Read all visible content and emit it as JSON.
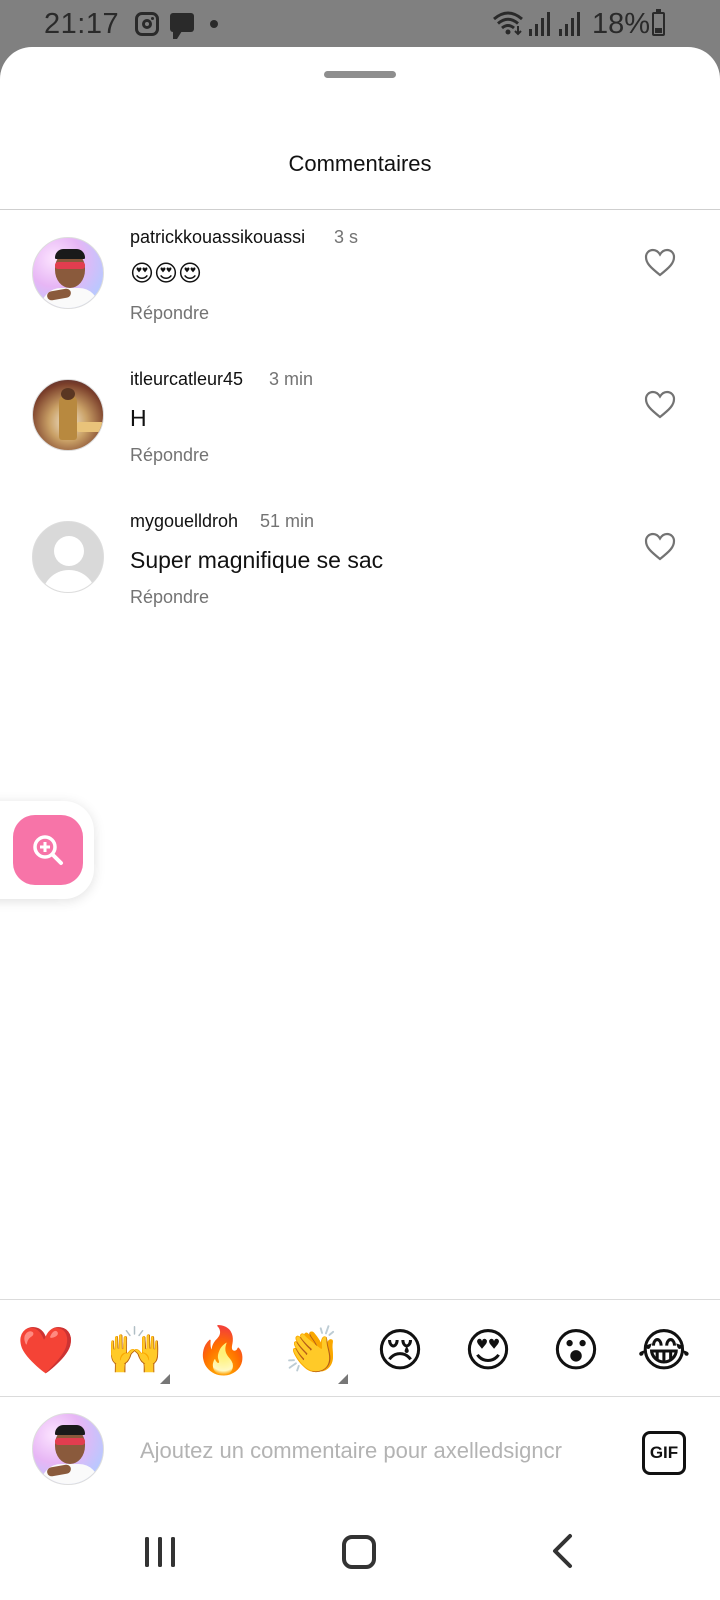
{
  "status_bar": {
    "time": "21:17",
    "battery": "18%",
    "icons": [
      "instagram-icon",
      "message-icon",
      "dot-icon",
      "wifi-icon",
      "signal-icon",
      "signal-icon",
      "battery-icon"
    ]
  },
  "sheet": {
    "title": "Commentaires"
  },
  "comments": [
    {
      "username": "patrickkouassikouassi",
      "time": "3 s",
      "text": "😍😍😍",
      "reply": "Répondre",
      "avatar": "cartoon-avatar"
    },
    {
      "username": "itleurcatleur45",
      "time": "3 min",
      "text": "H",
      "reply": "Répondre",
      "avatar": "photo-avatar"
    },
    {
      "username": "mygouelldroh",
      "time": "51 min",
      "text": "Super magnifique se sac",
      "reply": "Répondre",
      "avatar": "default-avatar"
    }
  ],
  "emoji_bar": [
    "❤️",
    "🙌",
    "🔥",
    "👏",
    "😢",
    "😍",
    "😮",
    "😂"
  ],
  "input": {
    "placeholder": "Ajoutez un commentaire pour axelledsigncr",
    "value": "",
    "gif_label": "GIF"
  },
  "colors": {
    "accent_pink": "#f774a8",
    "secondary_text": "#737373",
    "backdrop": "#808080"
  }
}
